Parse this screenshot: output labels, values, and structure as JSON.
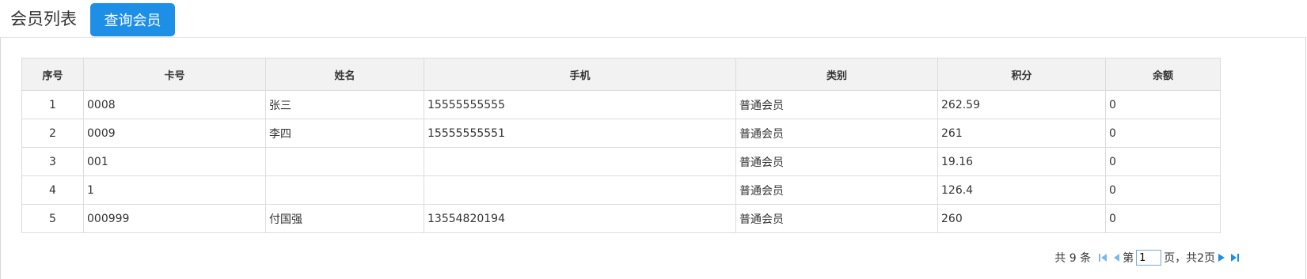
{
  "header": {
    "title": "会员列表",
    "query_button": "查询会员"
  },
  "table": {
    "columns": [
      {
        "key": "seq",
        "label": "序号"
      },
      {
        "key": "card",
        "label": "卡号"
      },
      {
        "key": "name",
        "label": "姓名"
      },
      {
        "key": "phone",
        "label": "手机"
      },
      {
        "key": "category",
        "label": "类别"
      },
      {
        "key": "points",
        "label": "积分"
      },
      {
        "key": "balance",
        "label": "余额"
      }
    ],
    "rows": [
      {
        "seq": "1",
        "card": "0008",
        "name": "张三",
        "phone": "15555555555",
        "category": "普通会员",
        "points": "262.59",
        "balance": "0"
      },
      {
        "seq": "2",
        "card": "0009",
        "name": "李四",
        "phone": "15555555551",
        "category": "普通会员",
        "points": "261",
        "balance": "0"
      },
      {
        "seq": "3",
        "card": "001",
        "name": "",
        "phone": "",
        "category": "普通会员",
        "points": "19.16",
        "balance": "0"
      },
      {
        "seq": "4",
        "card": "1",
        "name": "",
        "phone": "",
        "category": "普通会员",
        "points": "126.4",
        "balance": "0"
      },
      {
        "seq": "5",
        "card": "000999",
        "name": "付国强",
        "phone": "13554820194",
        "category": "普通会员",
        "points": "260",
        "balance": "0"
      }
    ]
  },
  "pager": {
    "total_text": "共 9 条",
    "page_prefix": "第",
    "current_page": "1",
    "page_suffix": "页，共2页",
    "icons": [
      "first-page-icon",
      "prev-page-icon",
      "next-page-icon",
      "last-page-icon"
    ],
    "icon_color": "#1e8fe6"
  },
  "colors": {
    "accent": "#1e8fe6",
    "header_bg": "#f2f2f2",
    "border": "#dcdcdc"
  }
}
